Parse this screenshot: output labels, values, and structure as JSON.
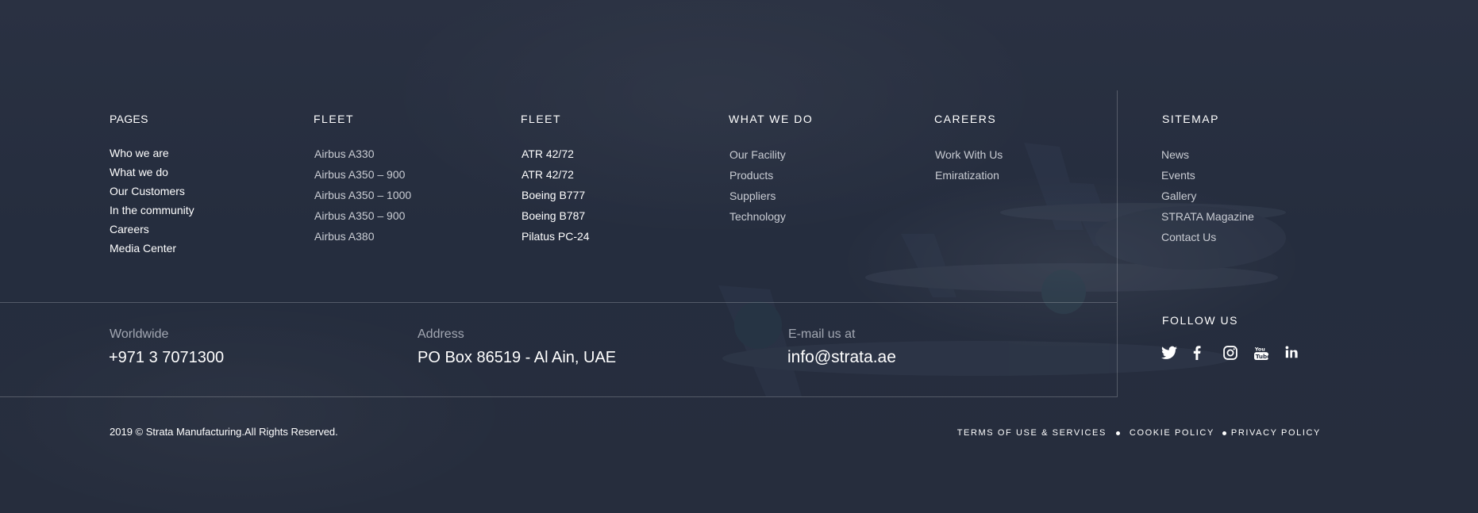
{
  "columns": {
    "pages": {
      "title": "PAGES",
      "items": [
        "Who we are",
        "What we do",
        "Our Customers",
        "In the community",
        "Careers",
        "Media Center"
      ]
    },
    "fleet1": {
      "title": "FLEET",
      "items": [
        "Airbus A330",
        "Airbus A350 – 900",
        "Airbus A350 – 1000",
        "Airbus A350 – 900",
        "Airbus A380"
      ]
    },
    "fleet2": {
      "title": "FLEET",
      "items": [
        "ATR 42/72",
        "ATR 42/72",
        "Boeing B777",
        "Boeing B787",
        "Pilatus PC-24"
      ]
    },
    "what_we_do": {
      "title": "WHAT WE DO",
      "items": [
        "Our Facility",
        "Products",
        "Suppliers",
        "Technology"
      ]
    },
    "careers": {
      "title": "CAREERS",
      "items": [
        "Work With Us",
        "Emiratization"
      ]
    },
    "sitemap": {
      "title": "SITEMAP",
      "items": [
        "News",
        "Events",
        "Gallery",
        "STRATA Magazine",
        "Contact Us"
      ]
    }
  },
  "contact": {
    "worldwide": {
      "label": "Worldwide",
      "value": "+971 3 7071300"
    },
    "address": {
      "label": "Address",
      "value": "PO Box 86519 - Al Ain, UAE"
    },
    "email": {
      "label": "E-mail us at",
      "value": "info@strata.ae"
    }
  },
  "follow": {
    "title": "FOLLOW US",
    "icons": [
      "twitter-icon",
      "facebook-icon",
      "instagram-icon",
      "youtube-icon",
      "linkedin-icon"
    ]
  },
  "footer": {
    "copyright": "2019 © Strata Manufacturing.All Rights Reserved.",
    "terms": "TERMS OF USE & SERVICES",
    "cookie": "COOKIE POLICY",
    "privacy": "PRIVACY POLICY"
  }
}
